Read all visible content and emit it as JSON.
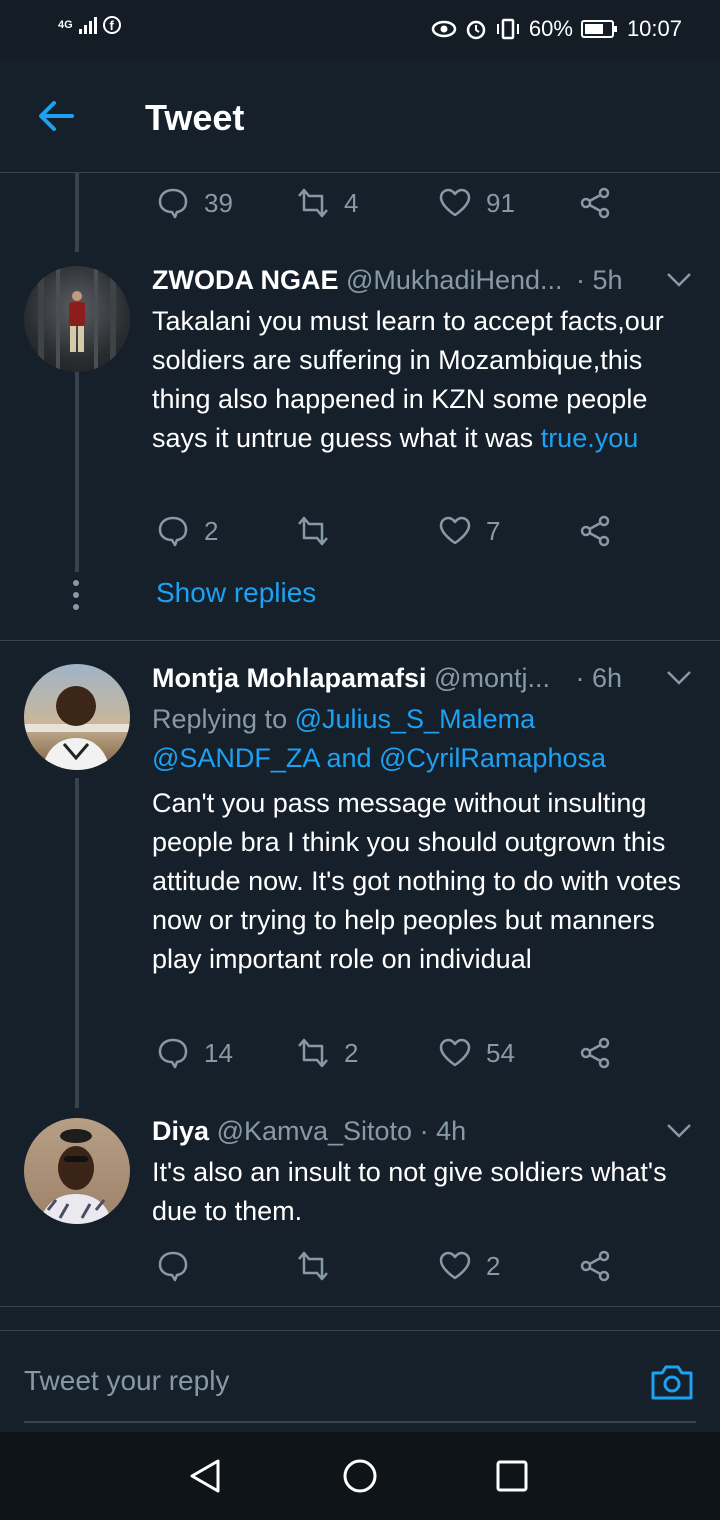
{
  "status_bar": {
    "network": "4G",
    "battery": "60%",
    "time": "10:07"
  },
  "header": {
    "title": "Tweet"
  },
  "top_actions": {
    "replies": "39",
    "retweets": "4",
    "likes": "91"
  },
  "tweets": [
    {
      "name": "ZWODA NGAE",
      "handle": "@MukhadiHend...",
      "time": "· 5h",
      "text": "Takalani you must learn to accept facts,our soldiers are suffering in Mozambique,this thing also happened in KZN some people says it untrue guess what it was ",
      "link_text": "true.you",
      "replies": "2",
      "retweets": "",
      "likes": "7",
      "show_replies": "Show replies"
    },
    {
      "name": "Montja Mohlapamafsi",
      "handle": "@montj...",
      "time": "· 6h",
      "replying_prefix": "Replying to ",
      "replying_to_1": "@Julius_S_Malema",
      "replying_to_2": "@SANDF_ZA",
      "replying_and": " and ",
      "replying_to_3": "@CyrilRamaphosa",
      "text": "Can't you pass message without insulting people bra I think you should outgrown this attitude now. It's got nothing to do with votes now or trying to help peoples but manners play important role on individual",
      "replies": "14",
      "retweets": "2",
      "likes": "54"
    },
    {
      "name": "Diya",
      "handle": "@Kamva_Sitoto",
      "time": "· 4h",
      "text": "It's also an insult to not give soldiers what's due to them.",
      "replies": "",
      "retweets": "",
      "likes": "2"
    }
  ],
  "reply_bar": {
    "placeholder": "Tweet your reply"
  },
  "colors": {
    "background": "#15202b",
    "accent": "#1da1f2",
    "muted": "#8899a6",
    "border": "#38444d"
  }
}
